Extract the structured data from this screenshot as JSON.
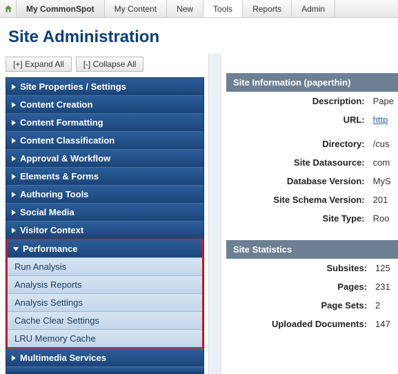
{
  "topbar": {
    "brand": "My CommonSpot",
    "tabs": [
      "My Content",
      "New",
      "Tools",
      "Reports",
      "Admin"
    ],
    "activeIndex": 2
  },
  "pageTitle": "Site Administration",
  "expand": {
    "expandAll": "[+] Expand All",
    "collapseAll": "[-] Collapse All"
  },
  "nav": {
    "items": [
      "Site Properties / Settings",
      "Content Creation",
      "Content Formatting",
      "Content Classification",
      "Approval & Workflow",
      "Elements & Forms",
      "Authoring Tools",
      "Social Media",
      "Visitor Context"
    ],
    "performance": {
      "label": "Performance",
      "subitems": [
        "Run Analysis",
        "Analysis Reports",
        "Analysis Settings",
        "Cache Clear Settings",
        "LRU Memory Cache"
      ]
    },
    "after": [
      "Multimedia Services"
    ]
  },
  "siteInfo": {
    "header": "Site Information (paperthin)",
    "rows": [
      {
        "label": "Description:",
        "value": "Pape"
      },
      {
        "label": "URL:",
        "value": "http",
        "link": true
      },
      {
        "label": "Directory:",
        "value": "/cus"
      },
      {
        "label": "Site Datasource:",
        "value": "com"
      },
      {
        "label": "Database Version:",
        "value": "MyS"
      },
      {
        "label": "Site Schema Version:",
        "value": "201"
      },
      {
        "label": "Site Type:",
        "value": "Roo"
      }
    ]
  },
  "siteStats": {
    "header": "Site Statistics",
    "rows": [
      {
        "label": "Subsites:",
        "value": "125"
      },
      {
        "label": "Pages:",
        "value": "231"
      },
      {
        "label": "Page Sets:",
        "value": "2"
      },
      {
        "label": "Uploaded Documents:",
        "value": "147"
      }
    ]
  }
}
